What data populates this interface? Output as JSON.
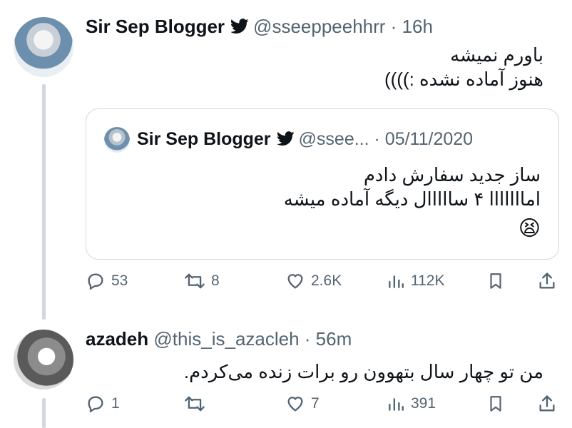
{
  "tweet": {
    "name": "Sir Sep Blogger",
    "handle_time": "@sseeppeehhrr · 16h",
    "lines": [
      "باورم نمیشه",
      "هنوز آماده نشده :))))"
    ],
    "icons": {
      "verified": "twitter-bird-icon"
    }
  },
  "quote": {
    "name": "Sir Sep Blogger",
    "handle_time": "@ssee... · 05/11/2020",
    "lines": [
      "ساز جدید سفارش دادم",
      "امااااااا ۴ سااااال دیگه آماده میشه"
    ],
    "emoji": "😫"
  },
  "tweet_actions": {
    "replies": "53",
    "retweets": "8",
    "likes": "2.6K",
    "views": "112K"
  },
  "reply": {
    "name": "azadeh",
    "handle_time": "@this_is_azacleh · 56m",
    "text": "من تو چهار سال بتهوون رو برات زنده می‌کردم."
  },
  "reply_actions": {
    "replies": "1",
    "retweets": "",
    "likes": "7",
    "views": "391"
  },
  "colors": {
    "text": "#0f1419",
    "muted": "#536471",
    "border": "#cfd9de"
  }
}
